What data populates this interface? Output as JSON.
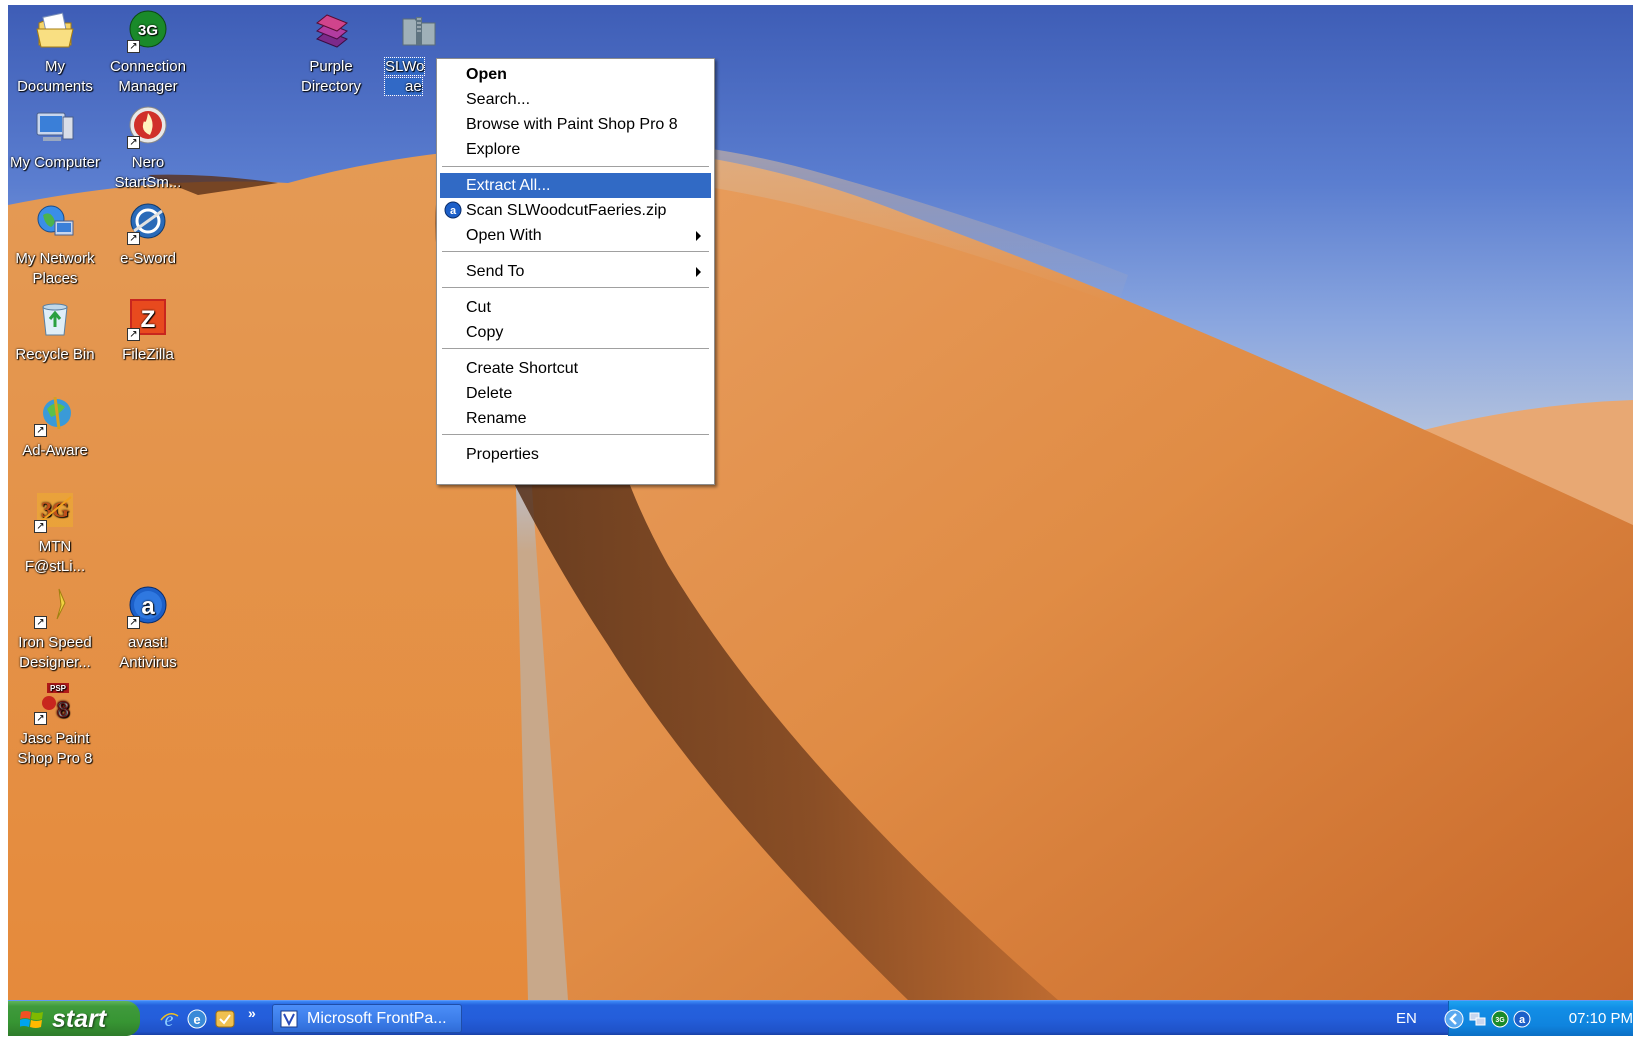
{
  "desktop": {
    "icons": [
      {
        "label": "My Documents",
        "icon": "my-documents-icon",
        "shortcut": false
      },
      {
        "label": "Connection Manager",
        "icon": "3g-connection-icon",
        "shortcut": true
      },
      {
        "label": "Purple Directory",
        "icon": "purple-books-icon",
        "shortcut": false
      },
      {
        "label": "SLWo",
        "label2": "ae",
        "icon": "zip-folder-icon",
        "shortcut": false,
        "selected": true
      },
      {
        "label": "My Computer",
        "icon": "my-computer-icon",
        "shortcut": false
      },
      {
        "label": "Nero StartSm...",
        "icon": "nero-flame-icon",
        "shortcut": true
      },
      {
        "label": "My Network Places",
        "icon": "network-globe-icon",
        "shortcut": false
      },
      {
        "label": "e-Sword",
        "icon": "e-sword-icon",
        "shortcut": true
      },
      {
        "label": "Recycle Bin",
        "icon": "recycle-bin-icon",
        "shortcut": false
      },
      {
        "label": "FileZilla",
        "icon": "filezilla-icon",
        "shortcut": true
      },
      {
        "label": "Ad-Aware",
        "icon": "ad-aware-icon",
        "shortcut": true
      },
      {
        "label": "MTN F@stLi...",
        "icon": "mtn-3g-icon",
        "shortcut": true
      },
      {
        "label": "Iron Speed Designer...",
        "icon": "iron-speed-icon",
        "shortcut": true
      },
      {
        "label": "avast! Antivirus",
        "icon": "avast-icon",
        "shortcut": true
      },
      {
        "label": "Jasc Paint Shop Pro 8",
        "icon": "paint-shop-pro-icon",
        "shortcut": true
      }
    ]
  },
  "context_menu": {
    "items": {
      "open": "Open",
      "search": "Search...",
      "browse_psp": "Browse with Paint Shop Pro 8",
      "explore": "Explore",
      "extract_all": "Extract All...",
      "scan": "Scan SLWoodcutFaeries.zip",
      "open_with": "Open With",
      "send_to": "Send To",
      "cut": "Cut",
      "copy": "Copy",
      "create_shortcut": "Create Shortcut",
      "delete": "Delete",
      "rename": "Rename",
      "properties": "Properties"
    },
    "highlighted": "extract_all"
  },
  "taskbar": {
    "start_label": "start",
    "quick_launch_chevron": "»",
    "task_button": "Microsoft FrontPa...",
    "language": "EN",
    "clock": "07:10 PM"
  },
  "colors": {
    "menu_highlight": "#316ac5",
    "taskbar_blue": "#245edb",
    "start_green": "#379533",
    "tray_blue": "#0f84de"
  }
}
